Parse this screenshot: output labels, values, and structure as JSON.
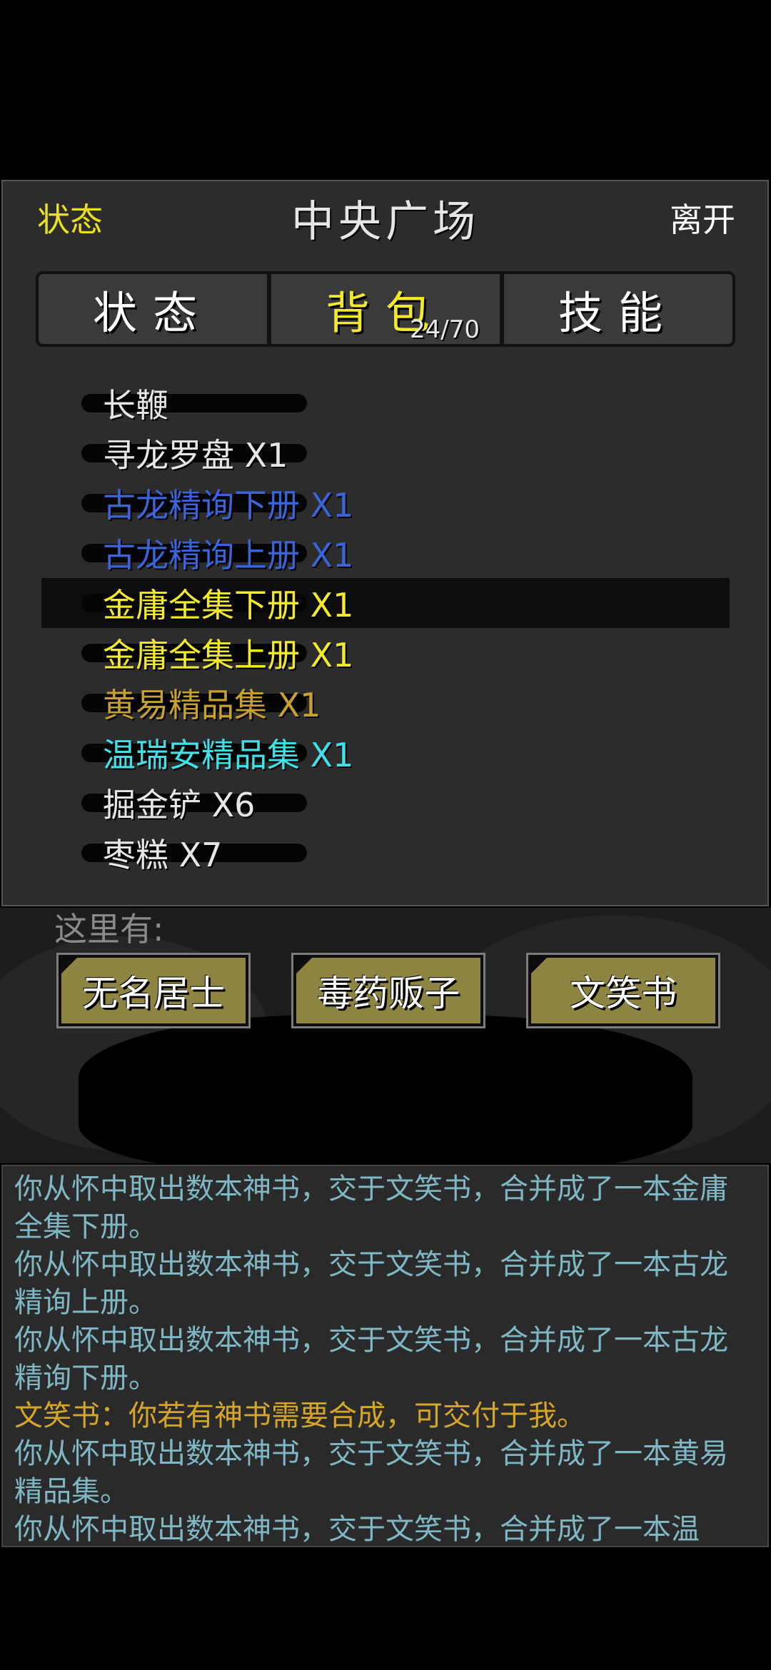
{
  "header": {
    "left_label": "状态",
    "title": "中央广场",
    "right_label": "离开"
  },
  "tabs": [
    {
      "label": "状态",
      "active": false
    },
    {
      "label": "背包",
      "active": true,
      "count": "24/70"
    },
    {
      "label": "技能",
      "active": false
    }
  ],
  "inventory": [
    {
      "name": "长鞭",
      "color": "#e6e6e6",
      "selected": false
    },
    {
      "name": "寻龙罗盘 X1",
      "color": "#e6e6e6",
      "selected": false
    },
    {
      "name": "古龙精询下册 X1",
      "color": "#3a64d8",
      "selected": false
    },
    {
      "name": "古龙精询上册 X1",
      "color": "#3a64d8",
      "selected": false
    },
    {
      "name": "金庸全集下册 X1",
      "color": "#f2e92a",
      "selected": true
    },
    {
      "name": "金庸全集上册 X1",
      "color": "#f2e92a",
      "selected": false
    },
    {
      "name": "黄易精品集 X1",
      "color": "#c8a030",
      "selected": false
    },
    {
      "name": "温瑞安精品集 X1",
      "color": "#40e0e8",
      "selected": false
    },
    {
      "name": "掘金铲 X6",
      "color": "#e6e6e6",
      "selected": false
    },
    {
      "name": "枣糕 X7",
      "color": "#e6e6e6",
      "selected": false
    }
  ],
  "here": {
    "label": "这里有:",
    "npcs": [
      "无名居士",
      "毒药贩子",
      "文笑书"
    ]
  },
  "log": [
    {
      "text": "你从怀中取出数本神书，交于文笑书，合并成了一本金庸全集下册。",
      "type": "system"
    },
    {
      "text": "你从怀中取出数本神书，交于文笑书，合并成了一本古龙精询上册。",
      "type": "system"
    },
    {
      "text": "你从怀中取出数本神书，交于文笑书，合并成了一本古龙精询下册。",
      "type": "system"
    },
    {
      "text": "文笑书：你若有神书需要合成，可交付于我。",
      "type": "speech"
    },
    {
      "text": "你从怀中取出数本神书，交于文笑书，合并成了一本黄易精品集。",
      "type": "system"
    },
    {
      "text": "你从怀中取出数本神书，交于文笑书，合并成了一本温",
      "type": "system"
    }
  ]
}
